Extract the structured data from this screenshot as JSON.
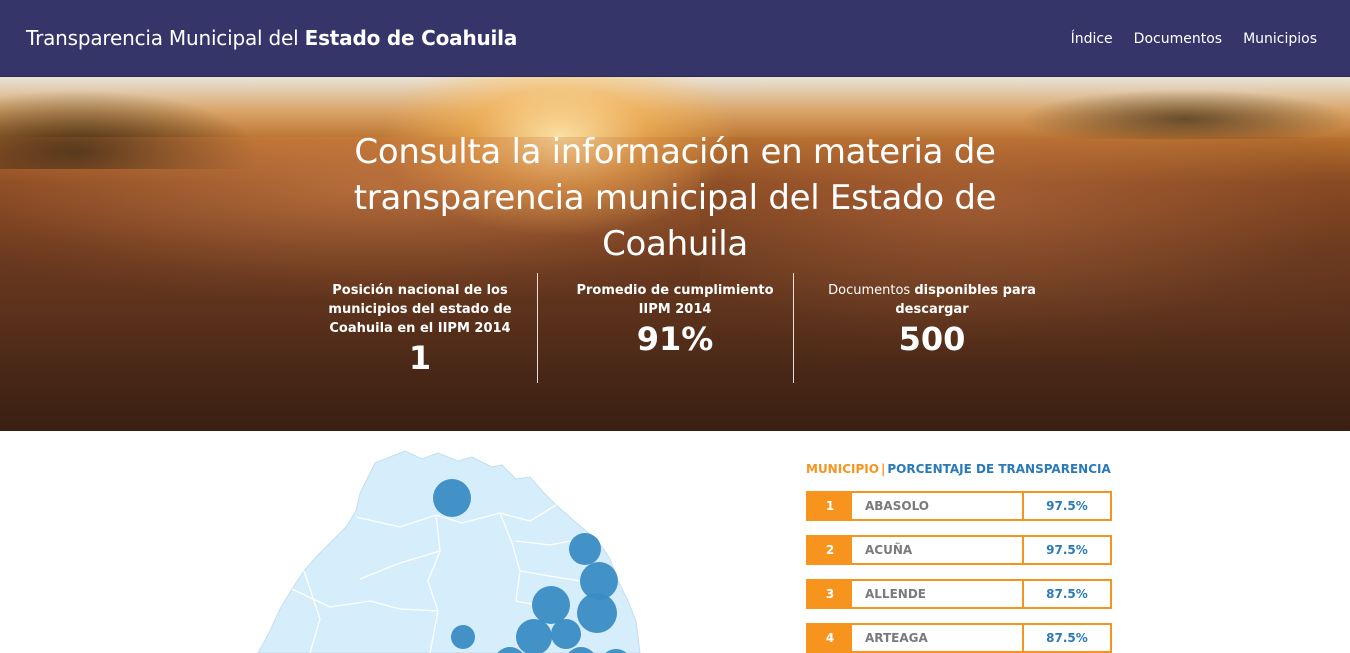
{
  "navbar": {
    "brand_light": "Transparencia Municipal del ",
    "brand_bold": "Estado de Coahuila",
    "links": [
      "Índice",
      "Documentos",
      "Municipios"
    ]
  },
  "hero": {
    "title": "Consulta la información en materia de transparencia municipal del Estado de Coahuila",
    "stats": [
      {
        "label": "Posición nacional de los municipios del estado de Coahuila en el IIPM 2014",
        "value": "1"
      },
      {
        "label": "Promedio de cumplimiento IIPM 2014",
        "value": "91%"
      },
      {
        "label_light": "Documentos ",
        "label_bold": "disponibles para descargar",
        "value": "500"
      }
    ]
  },
  "ranking": {
    "header_col1": "MUNICIPIO",
    "header_sep": "|",
    "header_col2": "PORCENTAJE DE TRANSPARENCIA",
    "rows": [
      {
        "num": "1",
        "name": "ABASOLO",
        "pct": "97.5%"
      },
      {
        "num": "2",
        "name": "ACUÑA",
        "pct": "97.5%"
      },
      {
        "num": "3",
        "name": "ALLENDE",
        "pct": "87.5%"
      },
      {
        "num": "4",
        "name": "ARTEAGA",
        "pct": "87.5%"
      }
    ]
  },
  "colors": {
    "navbar_bg": "#36356a",
    "accent_orange": "#f7941d",
    "accent_blue": "#2a7ab8",
    "map_fill": "#d6eefb",
    "bubble_fill": "#3a8cc4"
  }
}
